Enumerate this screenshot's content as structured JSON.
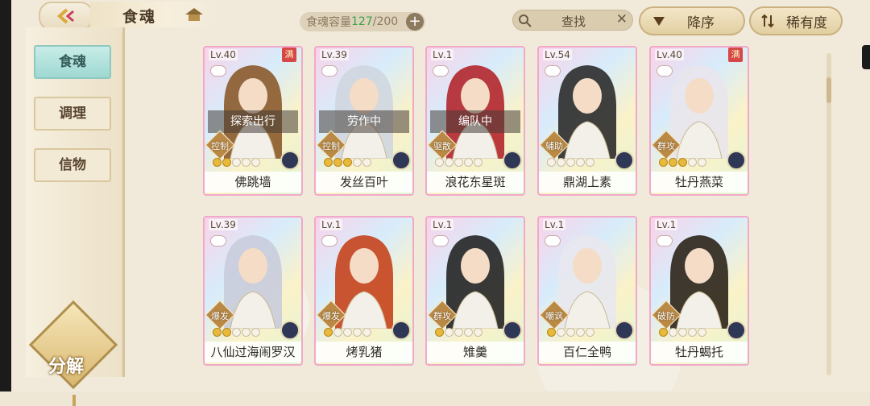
{
  "header": {
    "title": "食魂",
    "capacity_label": "食魂容量",
    "capacity_current": "127",
    "capacity_max": "/200",
    "search_label": "查找",
    "sort_label": "降序",
    "rarity_label": "稀有度"
  },
  "sidebar": {
    "tabs": [
      {
        "label": "食魂",
        "active": true
      },
      {
        "label": "调理",
        "active": false
      },
      {
        "label": "信物",
        "active": false
      }
    ],
    "decompose_label": "分解"
  },
  "cards": [
    {
      "level": "Lv.40",
      "max": "满",
      "status": "探索出行",
      "role": "控制",
      "stars": 2,
      "name": "佛跳墙",
      "hair": "#8b5a2b"
    },
    {
      "level": "Lv.39",
      "max": "",
      "status": "劳作中",
      "role": "控制",
      "stars": 3,
      "name": "发丝百叶",
      "hair": "#cfd6df"
    },
    {
      "level": "Lv.1",
      "max": "",
      "status": "编队中",
      "role": "驱散",
      "stars": 0,
      "name": "浪花东星斑",
      "hair": "#b3262c"
    },
    {
      "level": "Lv.54",
      "max": "",
      "status": "",
      "role": "辅助",
      "stars": 0,
      "name": "鼎湖上素",
      "hair": "#2b2b2b"
    },
    {
      "level": "Lv.40",
      "max": "满",
      "status": "",
      "role": "群攻",
      "stars": 3,
      "name": "牡丹燕菜",
      "hair": "#e9e6ec"
    },
    {
      "level": "Lv.39",
      "max": "",
      "status": "",
      "role": "爆发",
      "stars": 2,
      "name": "八仙过海闹罗汉",
      "hair": "#c9ccdc"
    },
    {
      "level": "Lv.1",
      "max": "",
      "status": "",
      "role": "爆发",
      "stars": 1,
      "name": "烤乳猪",
      "hair": "#c5421c"
    },
    {
      "level": "Lv.1",
      "max": "",
      "status": "",
      "role": "群攻",
      "stars": 1,
      "name": "雉羹",
      "hair": "#232323"
    },
    {
      "level": "Lv.1",
      "max": "",
      "status": "",
      "role": "嘲讽",
      "stars": 1,
      "name": "百仁全鸭",
      "hair": "#e8e8ee"
    },
    {
      "level": "Lv.1",
      "max": "",
      "status": "",
      "role": "破防",
      "stars": 1,
      "name": "牡丹蝎托",
      "hair": "#2c2418"
    }
  ]
}
